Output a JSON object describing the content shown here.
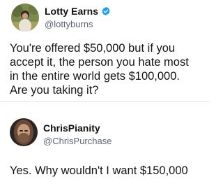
{
  "tweets": [
    {
      "display_name": "Lotty Earns",
      "handle": "@lottyburns",
      "verified": true,
      "text_lines": [
        "You're offered $50,000 but if you",
        "accept it, the person you hate most",
        "in the entire world gets $100,000.",
        "Are you taking it?"
      ]
    },
    {
      "display_name": "ChrisPianity",
      "handle": "@ChrisPurchase",
      "verified": false,
      "text_lines": [
        "Yes. Why wouldn't I want $150,000"
      ]
    }
  ],
  "colors": {
    "verified_badge": "#1d9bf0",
    "handle": "#5b6470",
    "text": "#141414"
  }
}
